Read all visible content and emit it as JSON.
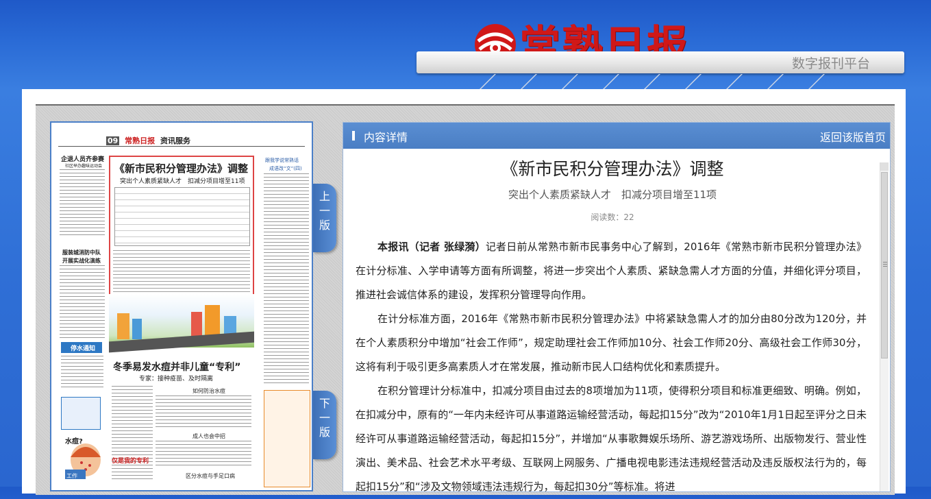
{
  "header": {
    "logo_text": "常熟日报",
    "platform_label": "数字报刊平台"
  },
  "newspaper_page": {
    "page_number": "09",
    "masthead": "常熟日报",
    "section": "资讯服务",
    "headline1": "《新市民积分管理办法》调整",
    "subhead1": "突出个人素质紧缺人才　扣减分项目增至11项",
    "headline2": "冬季易发水痘并非儿童“专利”",
    "subhead2": "专家：接种疫苗、及时隔离",
    "box1": "如何防治水痘",
    "box2": "成人也会中招",
    "box3": "区分水痘与手足口病",
    "left_head": "企退人员齐参赛",
    "left_sub": "社区举办趣味运动会",
    "left_head2": "服装城消防中队",
    "left_sub2": "开展实战化演练",
    "notice": "停水通知",
    "cartoon_word": "水痘?",
    "cartoon_label": "工作",
    "right_top": "跟我学说常熟话",
    "right_col_title": "成语改“文”(四)",
    "bottom_tag": "仅是我的专利"
  },
  "nav": {
    "prev_label": [
      "上",
      "一",
      "版"
    ],
    "next_label": [
      "下",
      "一",
      "版"
    ]
  },
  "panel": {
    "title": "内容详情",
    "back_link": "返回该版首页"
  },
  "article": {
    "title": "《新市民积分管理办法》调整",
    "subtitle": "突出个人素质紧缺人才　扣减分项目增至11项",
    "read_count": "阅读数：22",
    "lead": "本报讯（记者 张绿漪）",
    "p1": "记者日前从常熟市新市民事务中心了解到，2016年《常熟市新市民积分管理办法》在计分标准、入学申请等方面有所调整，将进一步突出个人素质、紧缺急需人才方面的分值，并细化评分项目，推进社会诚信体系的建设，发挥积分管理导向作用。",
    "p2": "在计分标准方面，2016年《常熟市新市民积分管理办法》中将紧缺急需人才的加分由80分改为120分，并在个人素质积分中增加“社会工作师”，规定助理社会工作师加10分、社会工作师20分、高级社会工作师30分，这将有利于吸引更多高素质人才在常发展，推动新市民人口结构优化和素质提升。",
    "p3": "在积分管理计分标准中，扣减分项目由过去的8项增加为11项，使得积分项目和标准更细致、明确。例如，在扣减分中，原有的“一年内未经许可从事道路运输经营活动，每起扣15分”改为“2010年1月1日起至评分之日未经许可从事道路运输经营活动，每起扣15分”，并增加“从事歌舞娱乐场所、游艺游戏场所、出版物发行、营业性演出、美术品、社会艺术水平考级、互联网上网服务、广播电视电影违法违规经营活动及违反版权法行为的，每起扣15分”和“涉及文物领域违法违规行为，每起扣30分”等标准。将进"
  },
  "colors": {
    "background_blue": "#2a66cf",
    "panel_header": "#4a7ec4",
    "logo_red": "#d01818"
  }
}
